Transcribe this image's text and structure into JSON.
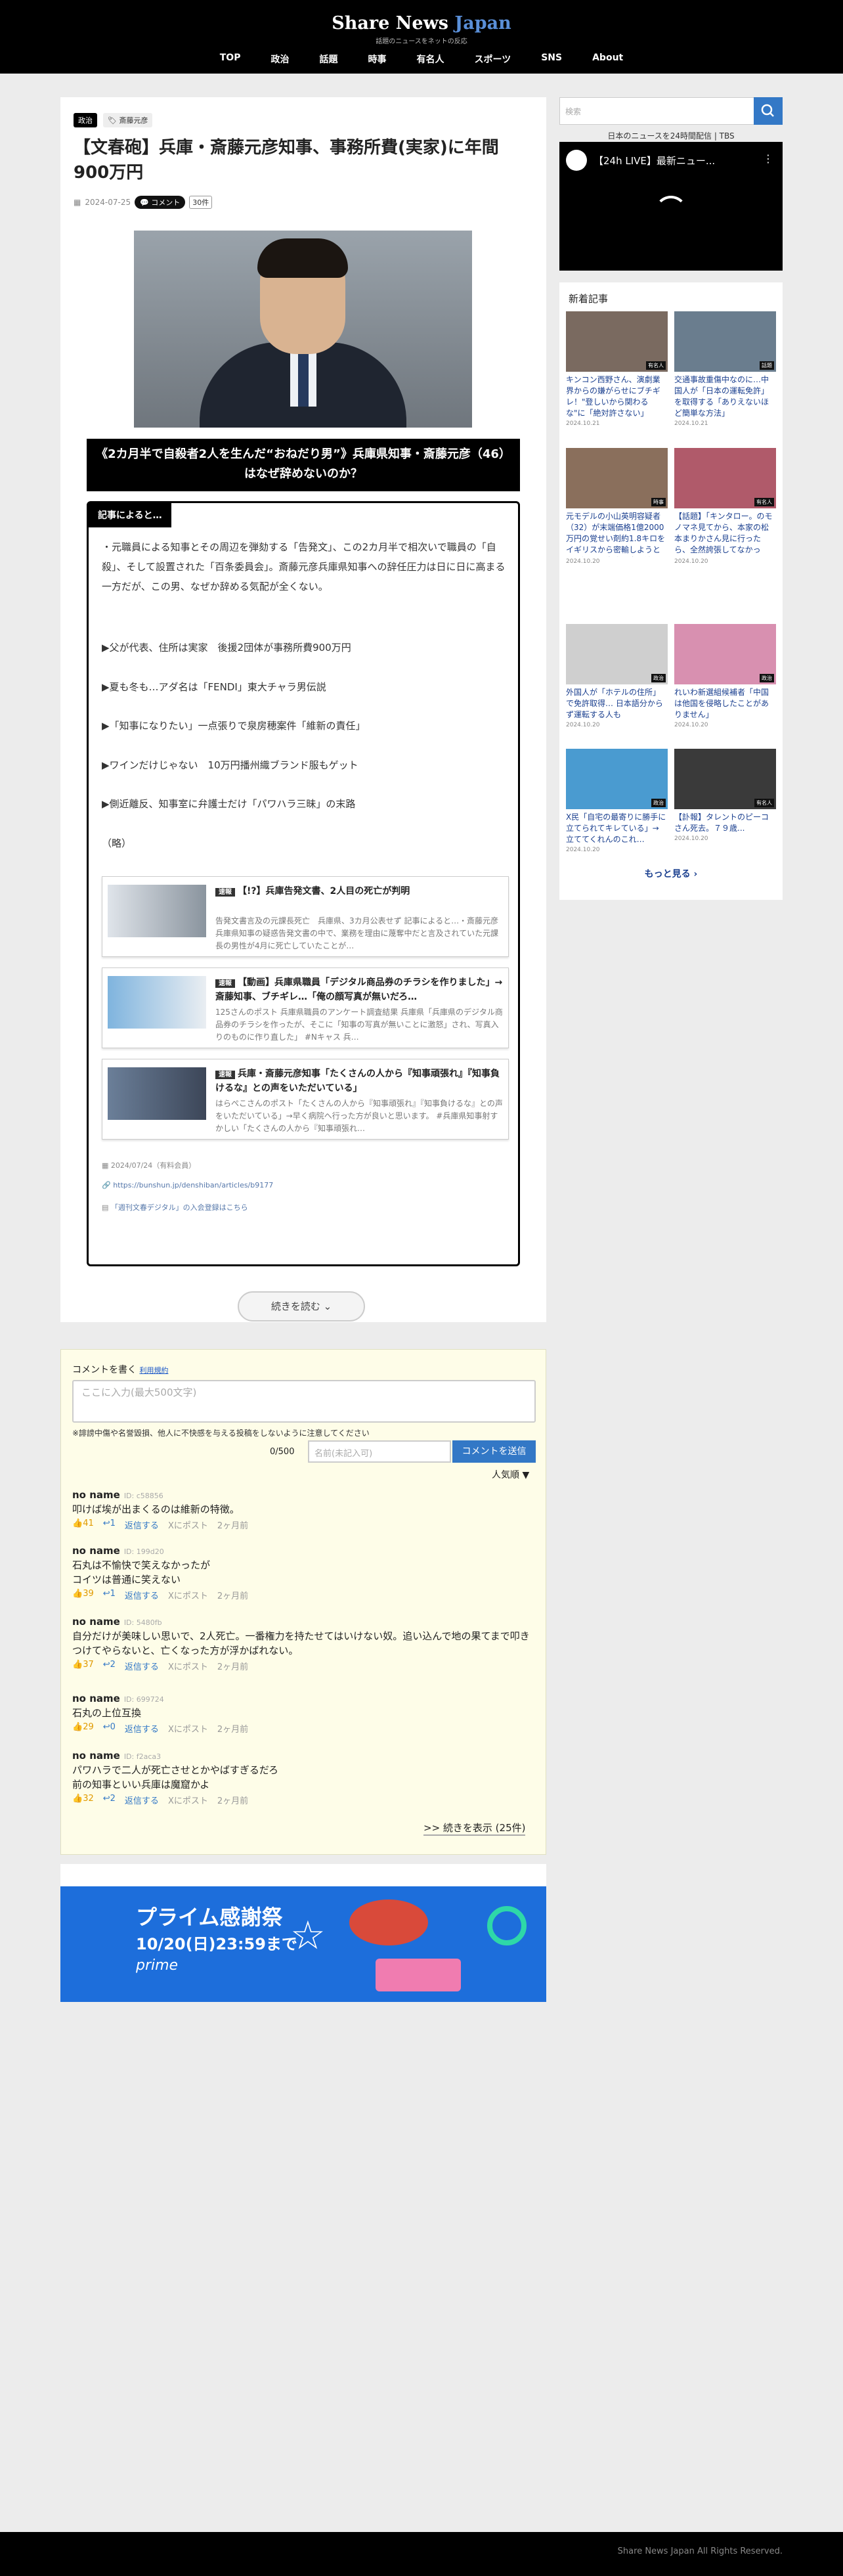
{
  "site": {
    "title_a": "Share News",
    "title_b": "Japan",
    "tagline": "話題のニュースをネットの反応"
  },
  "nav": [
    "TOP",
    "政治",
    "話題",
    "時事",
    "有名人",
    "スポーツ",
    "SNS",
    "About"
  ],
  "article": {
    "category": "政治",
    "tag": "斎藤元彦",
    "title": "【文春砲】兵庫・斎藤元彦知事、事務所費(実家)に年間900万円",
    "date": "2024-07-25",
    "comment_label": "コメント",
    "count_label": "30件",
    "subtitle": "《2カ月半で自殺者2人を生んだ“おねだり男”》兵庫県知事・斎藤元彦（46）はなぜ辞めないのか？",
    "box_label": "記事によると…",
    "intro": "・元職員による知事とその周辺を弾劾する「告発文」、この2カ月半で相次いで職員の「自殺」、そして設置された「百条委員会」。斎藤元彦兵庫県知事への辞任圧力は日に日に高まる一方だが、この男、なぜか辞める気配が全くない。",
    "bullets": [
      "▶父が代表、住所は実家　後援2団体が事務所費900万円",
      "▶夏も冬も…アダ名は「FENDI」東大チャラ男伝説",
      "▶「知事になりたい」一点張りで泉房穂案件「維新の責任」",
      "▶ワインだけじゃない　10万円播州織ブランド服もゲット",
      "▶側近離反、知事室に弁護士だけ「パワハラ三昧」の末路"
    ],
    "omission": "（略）",
    "related": [
      {
        "tag": "速報",
        "title": "【!?】兵庫告発文書、2人目の死亡が判明",
        "desc": "告発文書言及の元課長死亡　兵庫県、3カ月公表せず 記事によると…・斎藤元彦兵庫県知事の疑惑告発文書の中で、業務を理由に蔑奪中だと言及されていた元課長の男性が4月に死亡していたことが…"
      },
      {
        "tag": "速報",
        "title": "【動画】兵庫県職員「デジタル商品券のチラシを作りました」→ 斎藤知事、ブチギレ…「俺の顔写真が無いだろ…",
        "desc": "125さんのポスト 兵庫県職員のアンケート調査結果 兵庫県「兵庫県のデジタル商品券のチラシを作ったが、そこに「知事の写真が無いことに激怒」され、写真入りのものに作り直した」 #Nキャス 兵…"
      },
      {
        "tag": "速報",
        "title": "兵庫・斎藤元彦知事「たくさんの人から『知事頑張れ』『知事負けるな』との声をいただいている」",
        "desc": "はらぺこさんのポスト「たくさんの人から『知事頑張れ』『知事負けるな』との声をいただいている」→早く病院へ行った方が良いと思います。 #兵庫県知事射すかしい「たくさんの人から『知事頑張れ…"
      }
    ],
    "source_date": "2024/07/24（有料会員）",
    "source_url": "https://bunshun.jp/denshiban/articles/b9177",
    "source_note": "「週刊文春デジタル」の入会登録はこちら",
    "read_more": "続きを読む ⌄"
  },
  "comments": {
    "header": "コメントを書く",
    "rules": "利用規約",
    "placeholder": "ここに入力(最大500文字)",
    "notice": "※誹謗中傷や名誉毀損、他人に不快感を与える投稿をしないように注意してください",
    "count": "0/500",
    "name_placeholder": "名前(未記入可)",
    "submit": "コメントを送信",
    "sort": "人気順 ▼",
    "items": [
      {
        "name": "no name",
        "id": "ID: c58856",
        "text": "叩けば埃が出まくるのは維新の特徴。",
        "likes": "41",
        "replies": "1",
        "reply": "返信する",
        "post": "Xにポスト",
        "time": "2ヶ月前"
      },
      {
        "name": "no name",
        "id": "ID: 199d20",
        "text": "石丸は不愉快で笑えなかったが\nコイツは普通に笑えない",
        "likes": "39",
        "replies": "1",
        "reply": "返信する",
        "post": "Xにポスト",
        "time": "2ヶ月前"
      },
      {
        "name": "no name",
        "id": "ID: 5480fb",
        "text": "自分だけが美味しい思いで、2人死亡。一番権力を持たせてはいけない奴。追い込んで地の果てまで叩きつけてやらないと、亡くなった方が浮かばれない。",
        "likes": "37",
        "replies": "2",
        "reply": "返信する",
        "post": "Xにポスト",
        "time": "2ヶ月前"
      },
      {
        "name": "no name",
        "id": "ID: 699724",
        "text": "石丸の上位互換",
        "likes": "29",
        "replies": "0",
        "reply": "返信する",
        "post": "Xにポスト",
        "time": "2ヶ月前"
      },
      {
        "name": "no name",
        "id": "ID: f2aca3",
        "text": "パワハラで二人が死亡させとかやばすぎるだろ\n前の知事といい兵庫は魔窟かよ",
        "likes": "32",
        "replies": "2",
        "reply": "返信する",
        "post": "Xにポスト",
        "time": "2ヶ月前"
      }
    ],
    "more": ">> 続きを表示 (25件)"
  },
  "ad": {
    "title": "プライム感謝祭",
    "date": "10/20(日)23:59まで",
    "brand": "prime"
  },
  "sidebar": {
    "search_placeholder": "検索",
    "video_caption": "日本のニュースを24時間配信 | TBS",
    "video_title": "【24h LIVE】最新ニュー...",
    "new_title": "新着記事",
    "items": [
      {
        "title": "キンコン西野さん、演劇業界からの嫌がらせにブチギレ！\"登しいから関わるな\"に「絶対許さない」",
        "date": "2024.10.21",
        "tag": "有名人",
        "bg": "#7a6a60"
      },
      {
        "title": "交通事故重傷中なのに…中国人が「日本の運転免許」を取得する「ありえないほど簡単な方法」",
        "date": "2024.10.21",
        "tag": "話題",
        "bg": "#6a7d8e"
      },
      {
        "title": "元モデルの小山英明容疑者（32）が末端価格1億2000万円の覚せい剤約1.8キロをイギリスから密輸しようとした疑いで告発…水に溶かして靴紐を密輸に",
        "date": "2024.10.20",
        "tag": "時事",
        "bg": "#8a6f5c"
      },
      {
        "title": "【話題】「キンタロー。のモノマネ見てから、本家の松本まりかさん見に行ったら、全然誇張してなかった…」",
        "date": "2024.10.20",
        "tag": "有名人",
        "bg": "#b05a6a"
      },
      {
        "title": "外国人が「ホテルの住所」で免許取得… 日本語分からず運転する人も",
        "date": "2024.10.20",
        "tag": "政治",
        "bg": "#cfcfcf"
      },
      {
        "title": "れいわ新選組候補者「中国は他国を侵略したことがありません」",
        "date": "2024.10.20",
        "tag": "政治",
        "bg": "#d890b0"
      },
      {
        "title": "X民「自宅の最寄りに勝手に立てられてキレている」→ 立ててくれんのこれ…",
        "date": "2024.10.20",
        "tag": "政治",
        "bg": "#4a9bd0"
      },
      {
        "title": "【訃報】タレントのピーコさん死去。７９歳...",
        "date": "2024.10.20",
        "tag": "有名人",
        "bg": "#3a3a3a"
      }
    ],
    "more": "もっと見る ›"
  },
  "footer": "Share News Japan All Rights Reserved."
}
